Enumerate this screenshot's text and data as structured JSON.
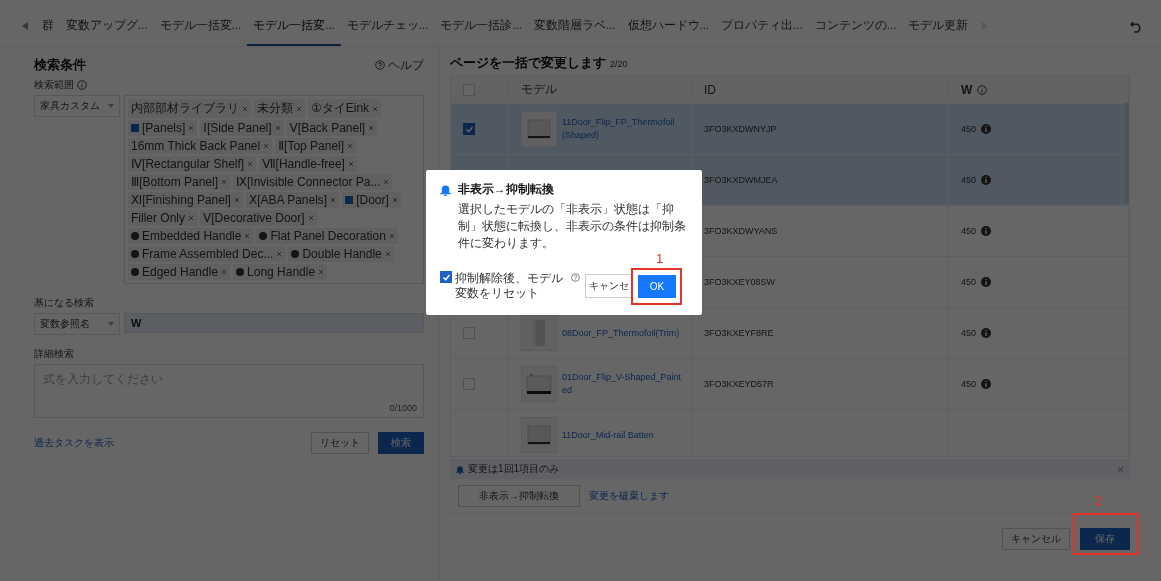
{
  "tabs": {
    "items": [
      {
        "label": "群",
        "selected": false
      },
      {
        "label": "変数アップグ...",
        "selected": false
      },
      {
        "label": "モデル一括変...",
        "selected": false
      },
      {
        "label": "モデル一括変...",
        "selected": true
      },
      {
        "label": "モデルチェッ...",
        "selected": false
      },
      {
        "label": "モデル一括診...",
        "selected": false
      },
      {
        "label": "変数階層ラベ...",
        "selected": false
      },
      {
        "label": "仮想ハードウ...",
        "selected": false
      },
      {
        "label": "プロパティ出...",
        "selected": false
      },
      {
        "label": "コンテンツの...",
        "selected": false
      },
      {
        "label": "モデル更新",
        "selected": false
      }
    ]
  },
  "search_panel": {
    "title": "検索条件",
    "help": "ヘルプ",
    "scope": {
      "label": "検索範囲",
      "select": "家具カスタム",
      "tags": [
        {
          "label": "内部部材ライブラリ",
          "kind": "plain"
        },
        {
          "label": "未分類",
          "kind": "plain"
        },
        {
          "label": "①タイEink",
          "kind": "plain"
        },
        {
          "label": "[Panels]",
          "kind": "group"
        },
        {
          "label": "Ⅰ[Side Panel]",
          "kind": "plain"
        },
        {
          "label": "Ⅴ[Back Panel]",
          "kind": "plain"
        },
        {
          "label": "16mm Thick Back Panel",
          "kind": "plain"
        },
        {
          "label": "Ⅱ[Top Panel]",
          "kind": "plain"
        },
        {
          "label": "Ⅳ[Rectangular Shelf]",
          "kind": "plain"
        },
        {
          "label": "Ⅶ[Handle-free]",
          "kind": "plain"
        },
        {
          "label": "Ⅲ[Bottom Panel]",
          "kind": "plain"
        },
        {
          "label": "Ⅸ[Invisible Connector Pa...",
          "kind": "plain"
        },
        {
          "label": "Ⅺ[Finishing Panel]",
          "kind": "plain"
        },
        {
          "label": "Ⅹ[ABA Panels]",
          "kind": "plain"
        },
        {
          "label": "[Door]",
          "kind": "group"
        },
        {
          "label": "Filler Only",
          "kind": "plain"
        },
        {
          "label": "Ⅴ[Decorative Door]",
          "kind": "plain"
        },
        {
          "label": "Embedded Handle",
          "kind": "handle"
        },
        {
          "label": "Flat Panel Decoration",
          "kind": "handle"
        },
        {
          "label": "Frame Assembled Dec...",
          "kind": "handle"
        },
        {
          "label": "Double Handle",
          "kind": "handle"
        },
        {
          "label": "Edged Handle",
          "kind": "handle"
        },
        {
          "label": "Long Handle",
          "kind": "handle"
        }
      ]
    },
    "base": {
      "label": "基になる検索",
      "select": "変数参照名",
      "value": "W"
    },
    "detail": {
      "label": "詳細検索",
      "placeholder": "式を入力してください",
      "counter": "0/1000"
    },
    "history_link": "過去タスクを表示",
    "reset": "リセット",
    "search": "検索"
  },
  "results_panel": {
    "title": "ページを一括で変更します",
    "count": "2/20",
    "select_all_checked": false,
    "columns": [
      "モデル",
      "ID",
      "W"
    ],
    "rows": [
      {
        "selected": true,
        "checked": true,
        "name": "11Door_Flip_FP_Thermofoil(Shaped)",
        "id": "3FO3KXDWNYJP",
        "w": "450"
      },
      {
        "selected": true,
        "id": "3FO3KXDWMJEA",
        "w": "450"
      },
      {
        "selected": false,
        "id": "3FO3KXDWYANS",
        "w": "450"
      },
      {
        "selected": false,
        "id": "3FO3KXEY08SW",
        "w": "450"
      },
      {
        "selected": false,
        "checked": false,
        "name": "08Door_FP_Thermofoil(Trim)",
        "id": "3FO3KXEYF8RE",
        "w": "450"
      },
      {
        "selected": false,
        "checked": false,
        "name": "01Door_Flip_V-Shaped_Painted",
        "id": "3FO3KXEYD57R",
        "w": "450"
      },
      {
        "selected": false,
        "name": "11Door_Mid-rail Batten"
      }
    ],
    "notice": "変更は1回1項目のみ",
    "convert_button": "非表示→抑制転換",
    "discard_link": "変更を破棄します",
    "cancel": "キャンセル",
    "save": "保存",
    "save_annotation": "2"
  },
  "dialog": {
    "title": "非表示→抑制転換",
    "body": "選択したモデルの「非表示」状態は「抑制」状態に転換し、非表示の条件は抑制条件に変わります。",
    "checkbox": {
      "label": "抑制解除後、モデル変数をリセット",
      "checked": true
    },
    "cancel": "キャンセ",
    "ok": "OK",
    "ok_annotation": "1"
  }
}
